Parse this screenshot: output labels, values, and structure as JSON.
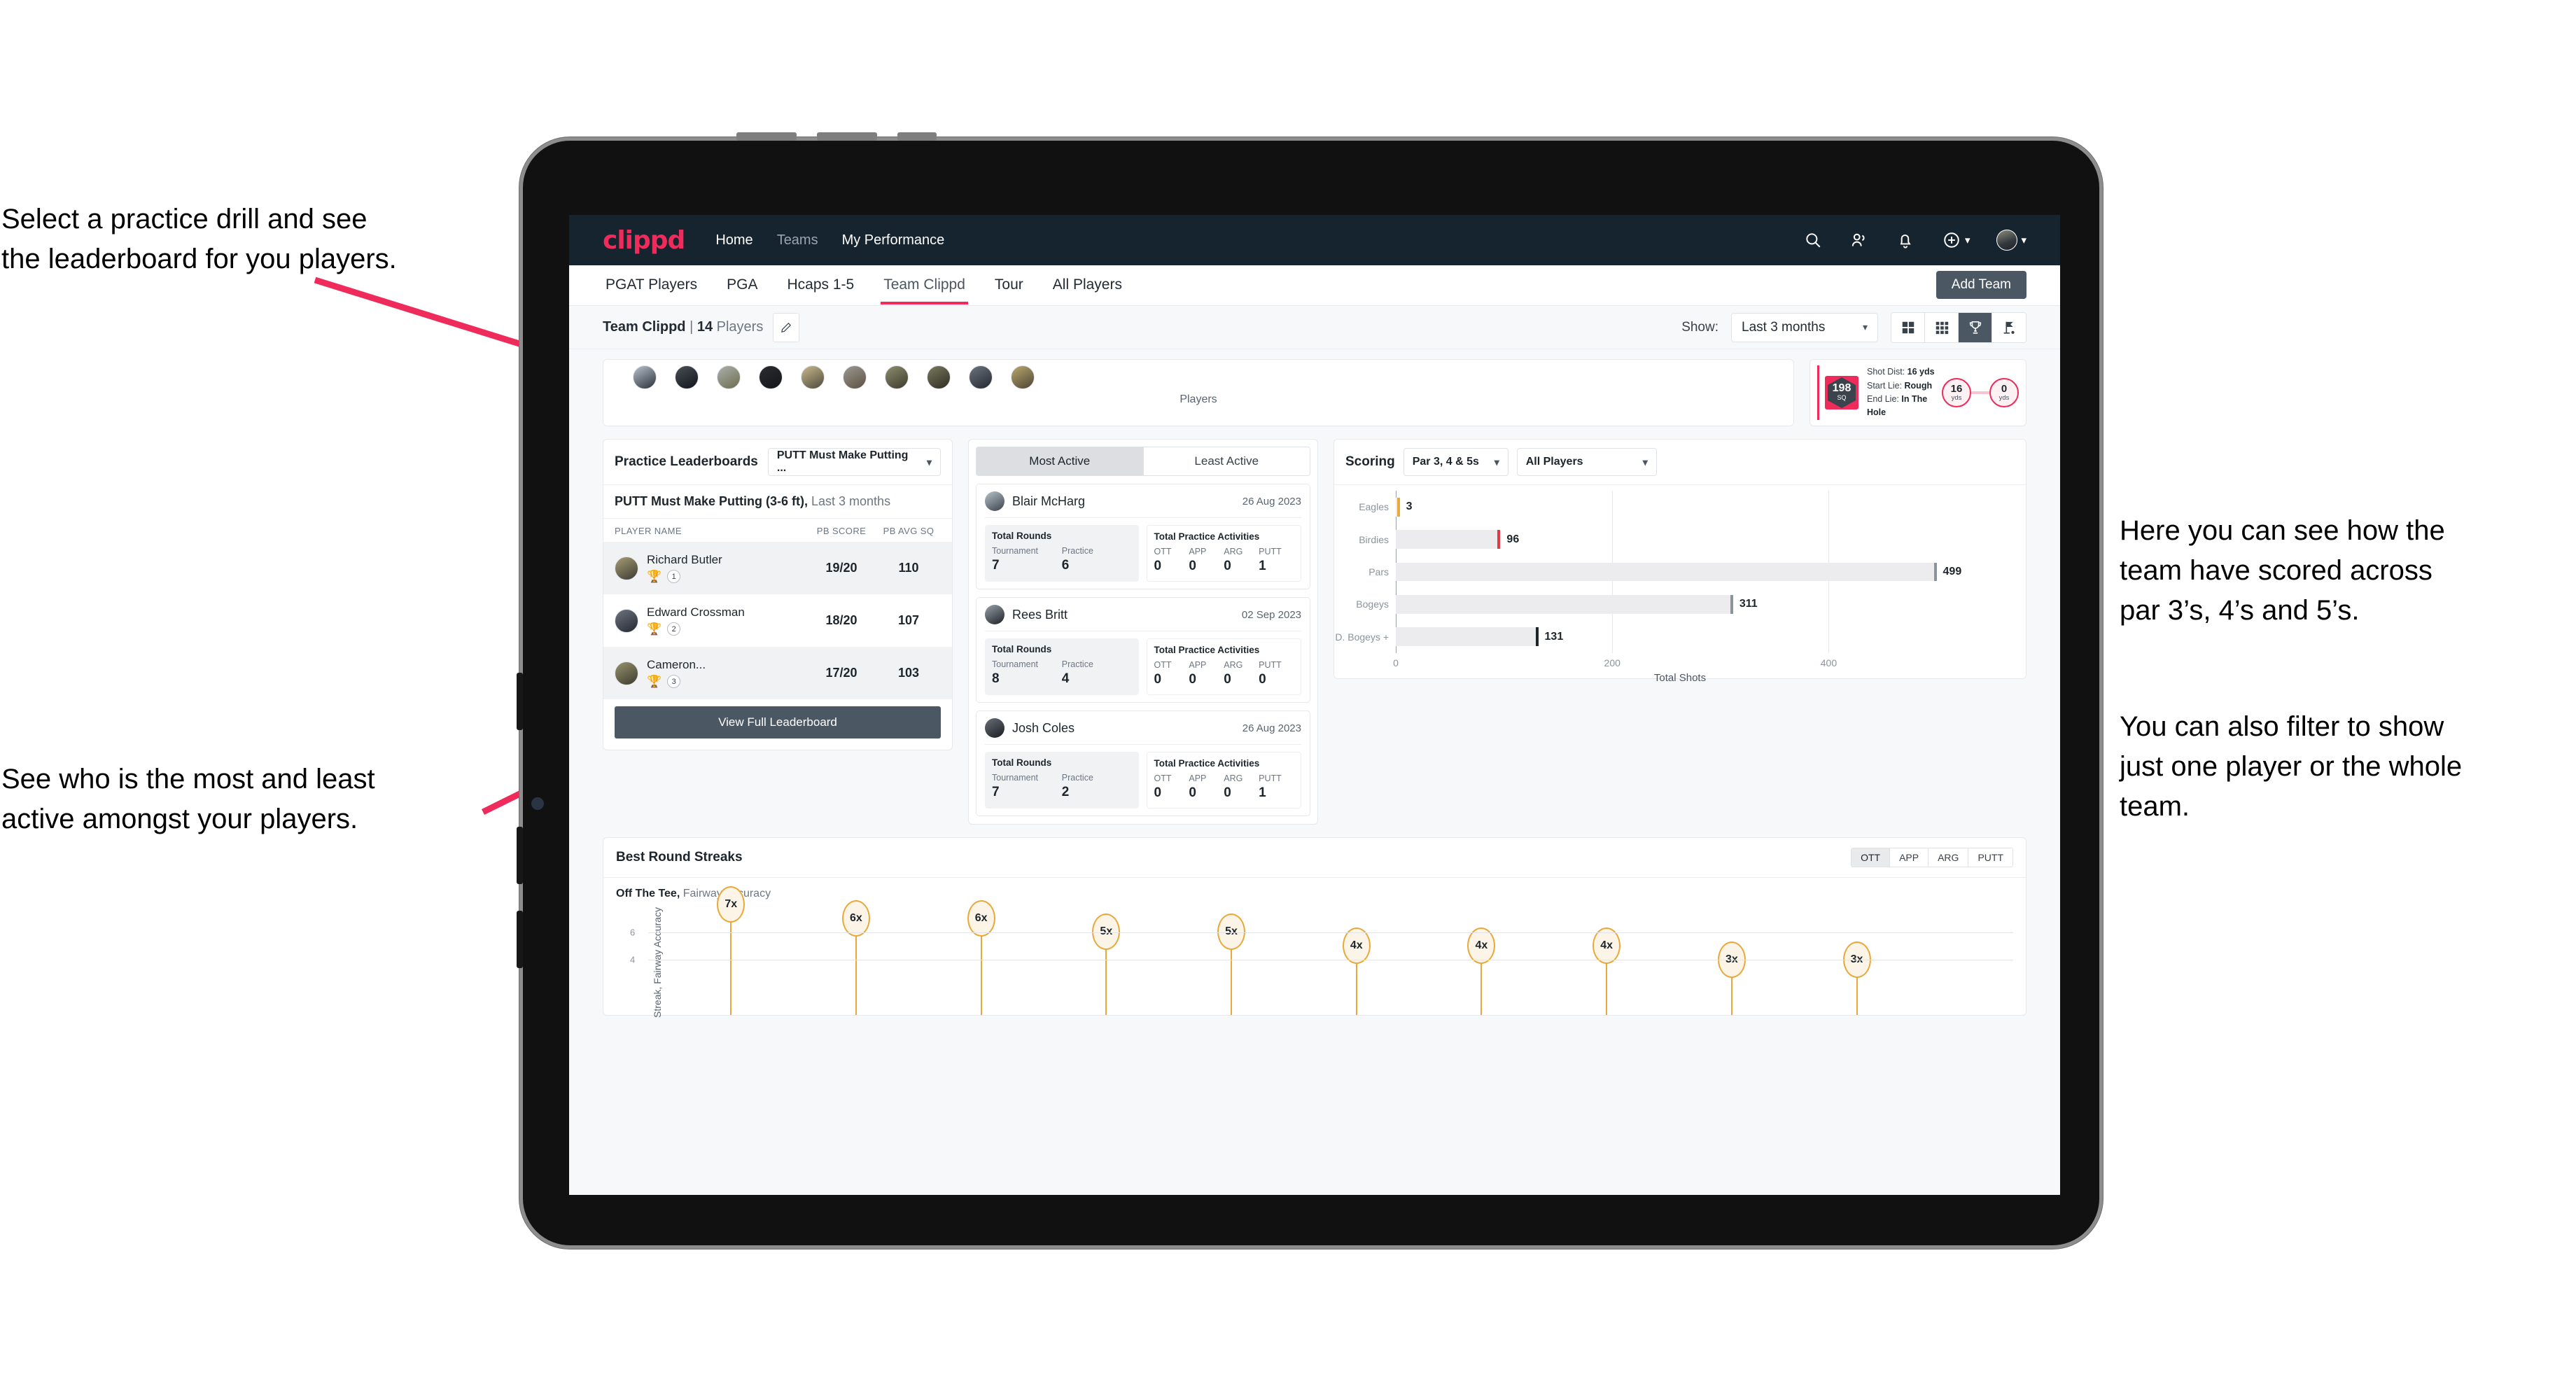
{
  "annotations": {
    "practice": "Select a practice drill and see\nthe leaderboard for you players.",
    "active": "See who is the most and least\nactive amongst your players.",
    "scoring": "Here you can see how the\nteam have scored across\npar 3’s, 4’s and 5’s.",
    "filter": "You can also filter to show\njust one player or the whole\nteam."
  },
  "topnav": {
    "logo": "clippd",
    "links": [
      {
        "label": "Home",
        "dim": false
      },
      {
        "label": "Teams",
        "dim": true
      },
      {
        "label": "My Performance",
        "dim": false
      }
    ],
    "icons": [
      "search-icon",
      "people-icon",
      "bell-icon",
      "plus-circle-icon",
      "avatar"
    ]
  },
  "subtabs": {
    "items": [
      {
        "label": "PGAT Players",
        "active": false
      },
      {
        "label": "PGA",
        "active": false
      },
      {
        "label": "Hcaps 1-5",
        "active": false
      },
      {
        "label": "Team Clippd",
        "active": true
      },
      {
        "label": "Tour",
        "active": false
      },
      {
        "label": "All Players",
        "active": false
      }
    ],
    "add_team": "Add Team"
  },
  "filterbar": {
    "team_name": "Team Clippd",
    "team_sep": " | ",
    "team_count": "14",
    "team_count_label": " Players",
    "edit_icon": "pencil-icon",
    "show_label": "Show:",
    "period": "Last 3 months",
    "views": [
      {
        "name": "grid-2x2-icon",
        "active": false
      },
      {
        "name": "grid-3x3-icon",
        "active": false
      },
      {
        "name": "trophy-icon",
        "active": true
      },
      {
        "name": "golf-flag-icon",
        "active": false
      }
    ]
  },
  "players_strip": {
    "label": "Players",
    "avatar_count": 10
  },
  "shot_card": {
    "sq_value": "198",
    "sq_label": "SQ",
    "rows": [
      {
        "label": "Shot Dist:",
        "value": "16 yds"
      },
      {
        "label": "Start Lie:",
        "value": "Rough"
      },
      {
        "label": "End Lie:",
        "value": "In The Hole"
      }
    ],
    "start_dist": "16",
    "start_unit": "yds",
    "end_dist": "0",
    "end_unit": "yds"
  },
  "leaderboard": {
    "title": "Practice Leaderboards",
    "drill_select": "PUTT Must Make Putting ...",
    "drill_title": "PUTT Must Make Putting (3-6 ft),",
    "drill_period": " Last 3 months",
    "columns": [
      "PLAYER NAME",
      "PB SCORE",
      "PB AVG SQ"
    ],
    "rows": [
      {
        "name": "Richard Butler",
        "rank": "1",
        "trophy": "gold",
        "score": "19/20",
        "sq": "110"
      },
      {
        "name": "Edward Crossman",
        "rank": "2",
        "trophy": "silver",
        "score": "18/20",
        "sq": "107"
      },
      {
        "name": "Cameron...",
        "rank": "3",
        "trophy": "bronze",
        "score": "17/20",
        "sq": "103"
      }
    ],
    "view_full": "View Full Leaderboard"
  },
  "activity": {
    "tabs": [
      {
        "label": "Most Active",
        "active": true
      },
      {
        "label": "Least Active",
        "active": false
      }
    ],
    "rounds_title": "Total Rounds",
    "rounds_cols": [
      "Tournament",
      "Practice"
    ],
    "practice_title": "Total Practice Activities",
    "practice_cols": [
      "OTT",
      "APP",
      "ARG",
      "PUTT"
    ],
    "players": [
      {
        "name": "Blair McHarg",
        "date": "26 Aug 2023",
        "tournament": "7",
        "practice": "6",
        "ott": "0",
        "app": "0",
        "arg": "0",
        "putt": "1"
      },
      {
        "name": "Rees Britt",
        "date": "02 Sep 2023",
        "tournament": "8",
        "practice": "4",
        "ott": "0",
        "app": "0",
        "arg": "0",
        "putt": "0"
      },
      {
        "name": "Josh Coles",
        "date": "26 Aug 2023",
        "tournament": "7",
        "practice": "2",
        "ott": "0",
        "app": "0",
        "arg": "0",
        "putt": "1"
      }
    ]
  },
  "scoring": {
    "title": "Scoring",
    "par_filter": "Par 3, 4 & 5s",
    "player_filter": "All Players"
  },
  "streaks": {
    "title": "Best Round Streaks",
    "toggle": [
      {
        "label": "OTT",
        "active": true
      },
      {
        "label": "APP",
        "active": false
      },
      {
        "label": "ARG",
        "active": false
      },
      {
        "label": "PUTT",
        "active": false
      }
    ],
    "subtitle_bold": "Off The Tee,",
    "subtitle_rest": " Fairway Accuracy"
  },
  "chart_data": [
    {
      "type": "bar",
      "orientation": "horizontal",
      "title": "Scoring",
      "categories": [
        "Eagles",
        "Birdies",
        "Pars",
        "Bogeys",
        "D. Bogeys +"
      ],
      "values": [
        3,
        96,
        499,
        311,
        131
      ],
      "cap_colors": [
        "#e8a93a",
        "#e63946",
        "#8b939b",
        "#8b939b",
        "#1d252c"
      ],
      "xlabel": "Total Shots",
      "ylabel": "",
      "xlim": [
        0,
        520
      ],
      "xticks": [
        0,
        200,
        400
      ],
      "grid": true,
      "legend": false
    },
    {
      "type": "scatter",
      "title": "Best Round Streaks",
      "subtitle": "Off The Tee, Fairway Accuracy",
      "ylabel": "Streak, Fairway Accuracy",
      "ylim": [
        0,
        7.6
      ],
      "yticks": [
        4,
        6
      ],
      "labels": [
        "7x",
        "6x",
        "6x",
        "5x",
        "5x",
        "4x",
        "4x",
        "4x",
        "3x",
        "3x"
      ],
      "values": [
        7,
        6,
        6,
        5,
        5,
        4,
        4,
        4,
        3,
        3
      ],
      "grid": true,
      "legend": false
    }
  ]
}
